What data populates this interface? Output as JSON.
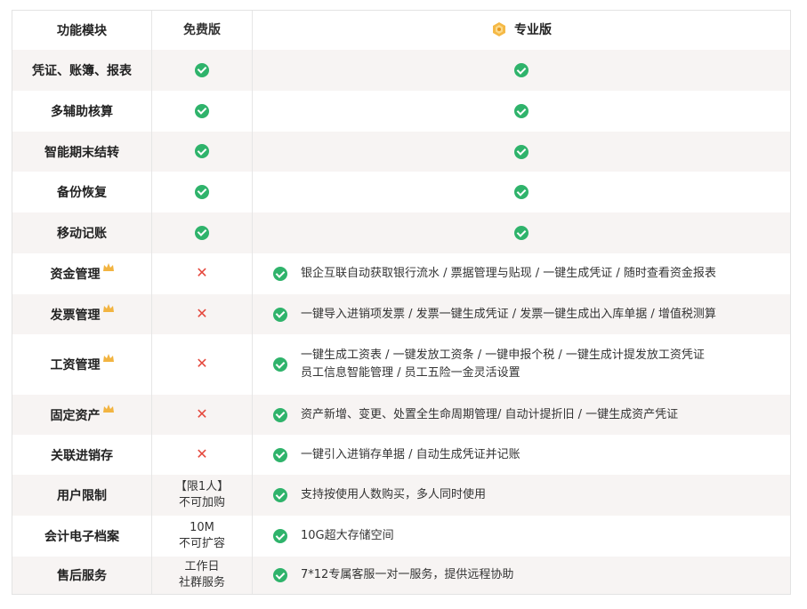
{
  "header": {
    "module": "功能模块",
    "free": "免费版",
    "pro": "专业版"
  },
  "colors": {
    "check": "#2fb36b",
    "cross": "#e5473c",
    "crown": "#f2b441",
    "alt_row": "#f7f4f3"
  },
  "rows": [
    {
      "name": "凭证、账簿、报表",
      "free": "check",
      "pro": "check"
    },
    {
      "name": "多辅助核算",
      "free": "check",
      "pro": "check"
    },
    {
      "name": "智能期末结转",
      "free": "check",
      "pro": "check"
    },
    {
      "name": "备份恢复",
      "free": "check",
      "pro": "check"
    },
    {
      "name": "移动记账",
      "free": "check",
      "pro": "check"
    },
    {
      "name": "资金管理",
      "free": "cross",
      "pro_text": [
        "银企互联自动获取银行流水 / 票据管理与贴现 / 一键生成凭证 / 随时查看资金报表"
      ]
    },
    {
      "name": "发票管理",
      "free": "cross",
      "pro_text": [
        "一键导入进销项发票 / 发票一键生成凭证 / 发票一键生成出入库单据 / 增值税测算"
      ]
    },
    {
      "name": "工资管理",
      "free": "cross",
      "pro_text": [
        "一键生成工资表 / 一键发放工资条 / 一键申报个税 / 一键生成计提发放工资凭证",
        "员工信息智能管理 / 员工五险一金灵活设置"
      ]
    },
    {
      "name": "固定资产",
      "free": "cross",
      "pro_text": [
        "资产新增、变更、处置全生命周期管理/ 自动计提折旧 / 一键生成资产凭证"
      ]
    },
    {
      "name": "关联进销存",
      "free": "cross",
      "pro_text": [
        "一键引入进销存单据 / 自动生成凭证并记账"
      ]
    },
    {
      "name": "用户限制",
      "free_text": [
        "【限1人】",
        "不可加购"
      ],
      "pro_text": [
        "支持按使用人数购买，多人同时使用"
      ]
    },
    {
      "name": "会计电子档案",
      "free_text": [
        "10M",
        "不可扩容"
      ],
      "pro_text": [
        "10G超大存储空间"
      ]
    },
    {
      "name": "售后服务",
      "free_text": [
        "工作日",
        "社群服务"
      ],
      "pro_text": [
        "7*12专属客服一对一服务，提供远程协助"
      ]
    }
  ]
}
